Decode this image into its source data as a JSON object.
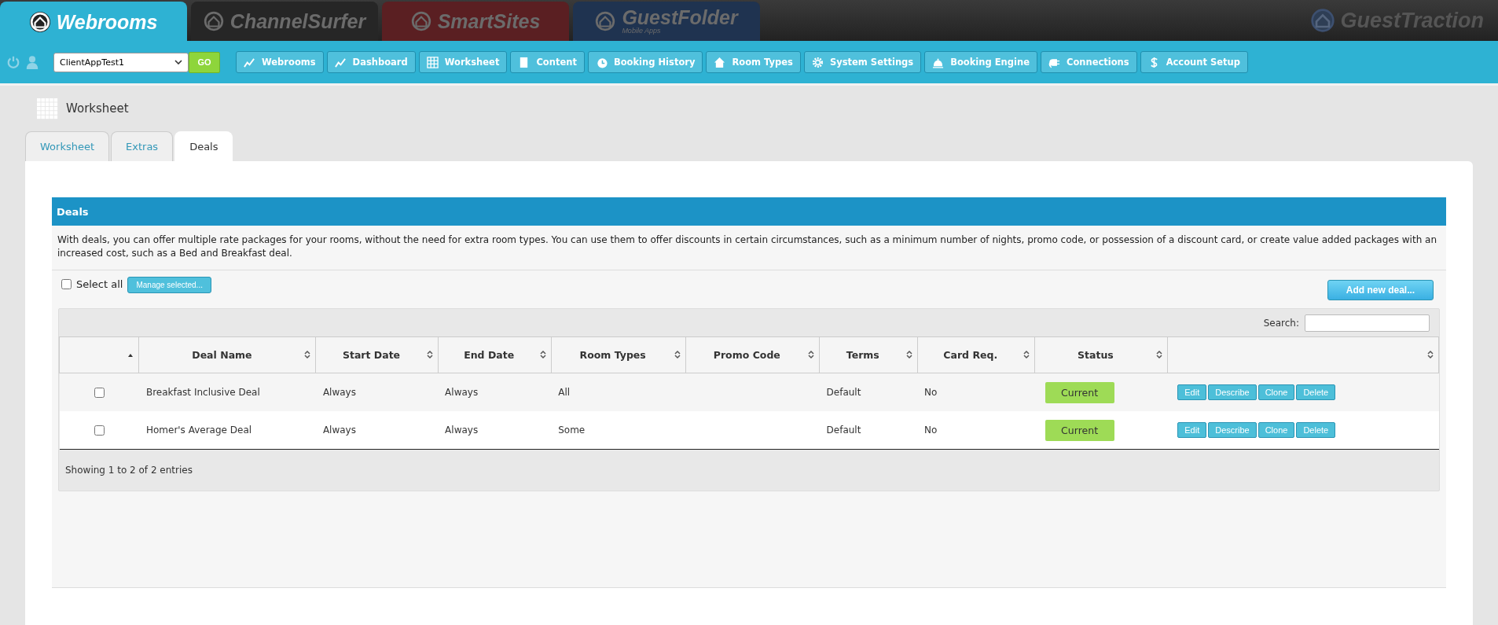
{
  "products": [
    {
      "label": "Webrooms",
      "selected": true,
      "color": "#2eb2d3"
    },
    {
      "label": "ChannelSurfer",
      "selected": false,
      "color": "#262626"
    },
    {
      "label": "SmartSites",
      "selected": false,
      "color": "#5a1f22"
    },
    {
      "label": "GuestFolder",
      "sublabel": "Mobile Apps",
      "selected": false,
      "color": "#1f3350"
    }
  ],
  "brand": "GuestTraction",
  "client_select": {
    "value": "ClientAppTest1"
  },
  "go_button": "GO",
  "nav": [
    {
      "label": "Webrooms",
      "kind": "chart"
    },
    {
      "label": "Dashboard",
      "kind": "chart"
    },
    {
      "label": "Worksheet",
      "kind": "grid"
    },
    {
      "label": "Content",
      "kind": "doc"
    },
    {
      "label": "Booking History",
      "kind": "history"
    },
    {
      "label": "Room Types",
      "kind": "home"
    },
    {
      "label": "System Settings",
      "kind": "gear"
    },
    {
      "label": "Booking Engine",
      "kind": "bell"
    },
    {
      "label": "Connections",
      "kind": "plug"
    },
    {
      "label": "Account Setup",
      "kind": "dollar"
    }
  ],
  "page_title": "Worksheet",
  "tabs": [
    {
      "label": "Worksheet",
      "selected": false
    },
    {
      "label": "Extras",
      "selected": false
    },
    {
      "label": "Deals",
      "selected": true
    }
  ],
  "panel": {
    "title": "Deals",
    "description": "With deals, you can offer multiple rate packages for your rooms, without the need for extra room types. You can use them to offer discounts in certain circumstances, such as a minimum number of nights, promo code, or possession of a discount card, or create value added packages with an increased cost, such as a Bed and Breakfast deal."
  },
  "select_all": {
    "label": "Select all",
    "checked": false
  },
  "manage_button": "Manage selected...",
  "add_button": "Add new deal...",
  "search_label": "Search:",
  "table": {
    "columns": [
      {
        "sorted": true
      },
      {
        "label": "Deal Name",
        "sorted": false
      },
      {
        "label": "Start Date",
        "sorted": false
      },
      {
        "label": "End Date",
        "sorted": false
      },
      {
        "label": "Room Types",
        "sorted": false
      },
      {
        "label": "Promo Code",
        "sorted": false
      },
      {
        "label": "Terms",
        "sorted": false
      },
      {
        "label": "Card Req.",
        "sorted": false
      },
      {
        "label": "Status",
        "sorted": false
      },
      {
        "sorted": false
      }
    ],
    "rows": [
      {
        "checked": false,
        "cells": [
          "",
          "Breakfast Inclusive Deal",
          "Always",
          "Always",
          "All",
          "",
          "Default",
          "No",
          "Current"
        ],
        "actions": [
          "Edit",
          "Describe",
          "Clone",
          "Delete"
        ]
      },
      {
        "checked": false,
        "cells": [
          "",
          "Homer's Average Deal",
          "Always",
          "Always",
          "Some",
          "",
          "Default",
          "No",
          "Current"
        ],
        "actions": [
          "Edit",
          "Describe",
          "Clone",
          "Delete"
        ]
      }
    ],
    "info": "Showing 1 to 2 of 2 entries"
  }
}
